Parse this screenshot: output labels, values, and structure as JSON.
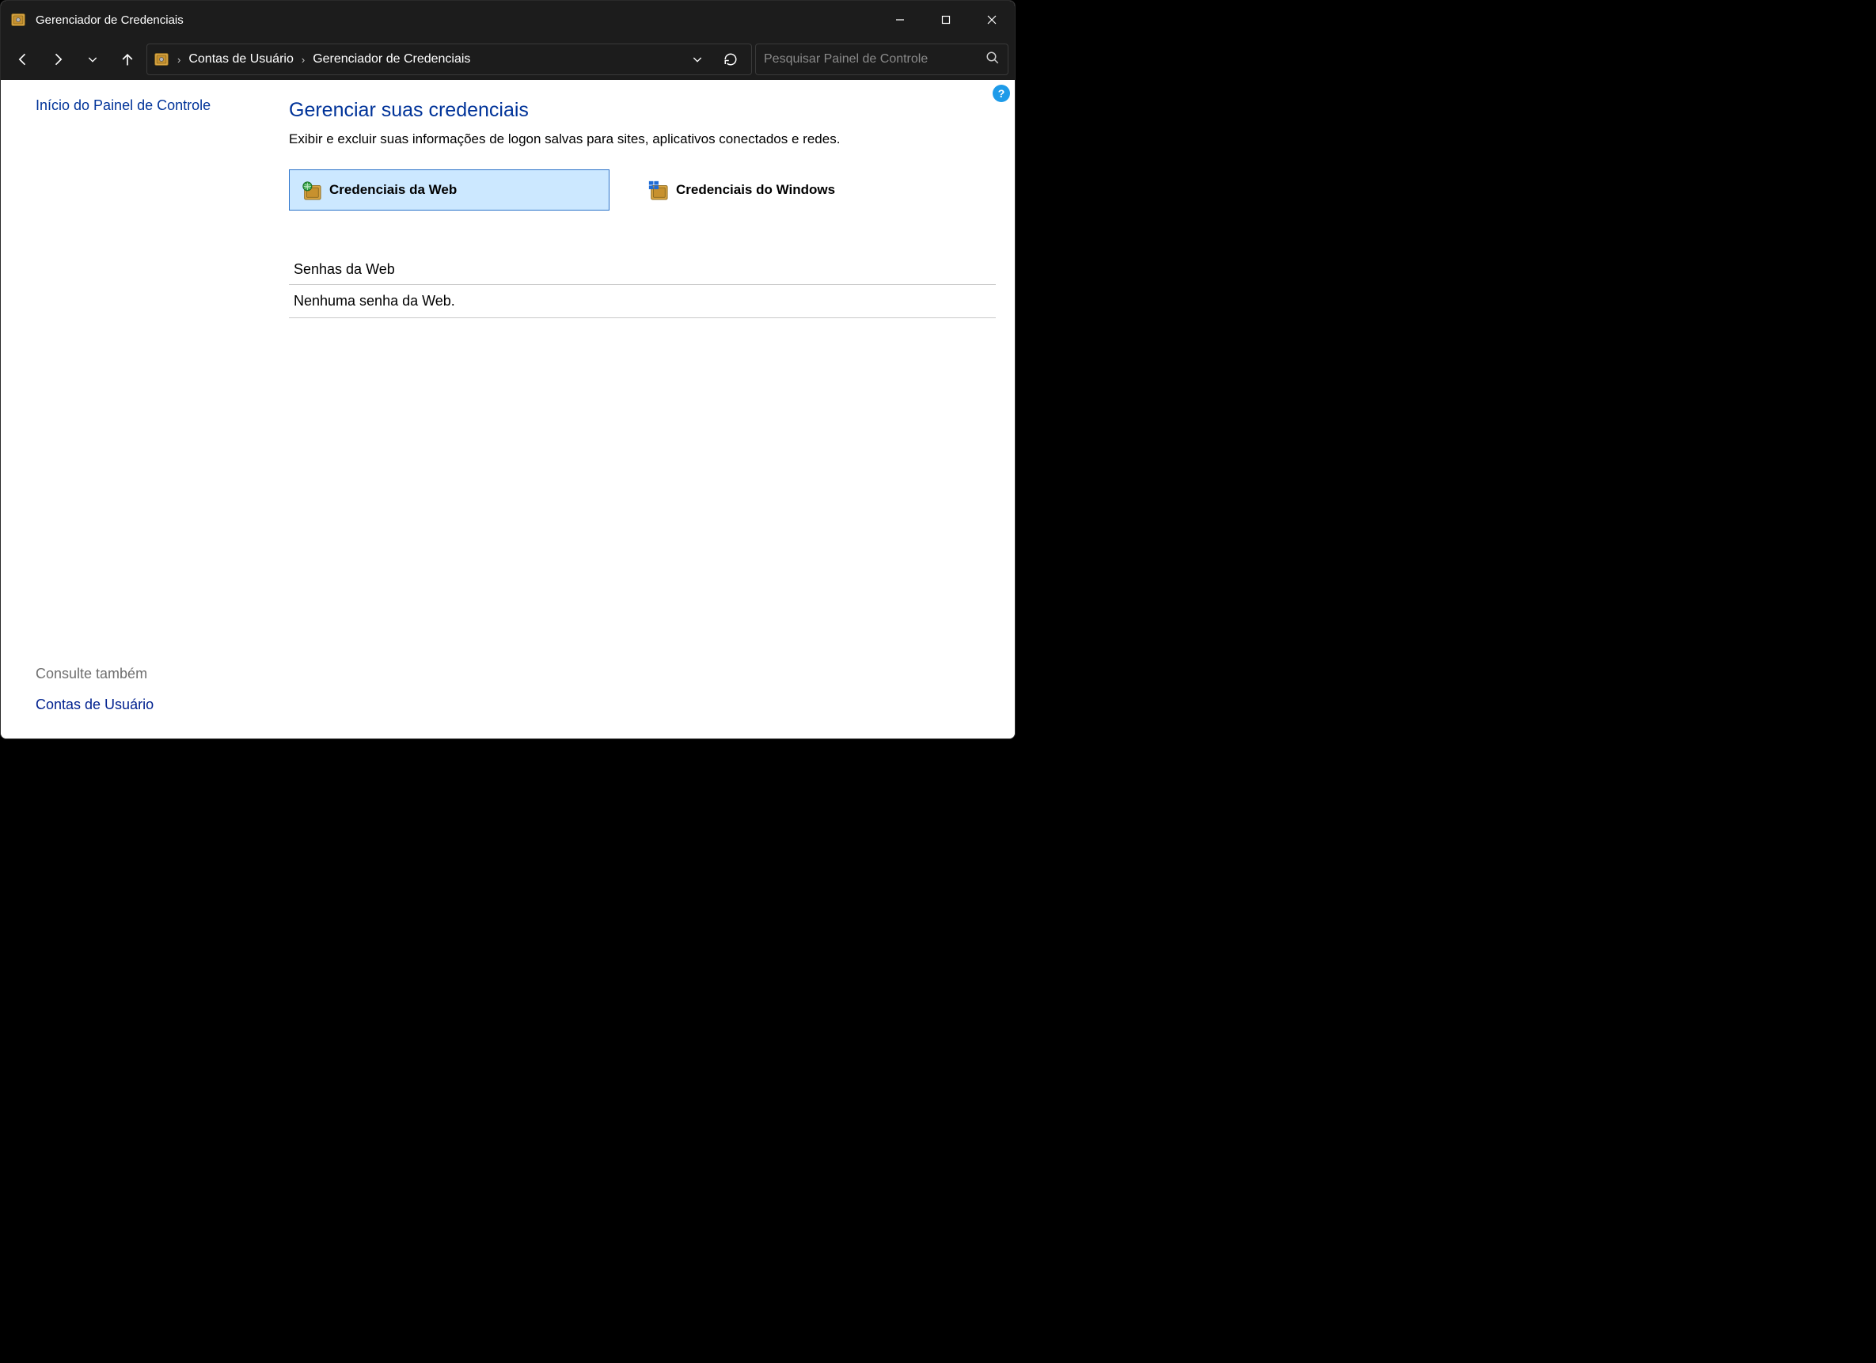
{
  "window": {
    "title": "Gerenciador de Credenciais"
  },
  "breadcrumb": {
    "part1": "Contas de Usuário",
    "part2": "Gerenciador de Credenciais"
  },
  "search": {
    "placeholder": "Pesquisar Painel de Controle"
  },
  "sidebar": {
    "home_link": "Início do Painel de Controle",
    "see_also": "Consulte também",
    "bottom_link": "Contas de Usuário"
  },
  "main": {
    "heading": "Gerenciar suas credenciais",
    "description": "Exibir e excluir suas informações de logon salvas para sites, aplicativos conectados e redes.",
    "card_web": "Credenciais da Web",
    "card_windows": "Credenciais do Windows",
    "section_title": "Senhas da Web",
    "section_empty": "Nenhuma senha da Web."
  },
  "help": {
    "symbol": "?"
  }
}
